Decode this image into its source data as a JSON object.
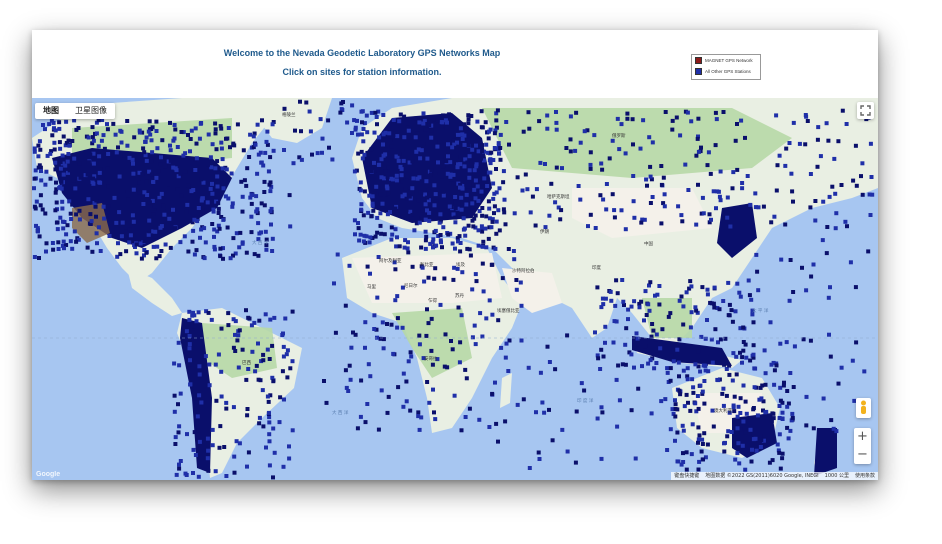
{
  "header": {
    "title": "Welcome to the Nevada Geodetic Laboratory GPS Networks Map",
    "subtitle": "Click on sites for station information."
  },
  "legend": {
    "items": [
      {
        "label": "MAGNET GPS Network",
        "color": "#8b1a1a"
      },
      {
        "label": "All Other GPS Stations",
        "color": "#1f2fa8"
      }
    ]
  },
  "map_controls": {
    "map_type_map": "地图",
    "map_type_satellite": "卫星图像",
    "zoom_in": "+",
    "zoom_out": "−"
  },
  "map_labels": {
    "atlantic_n": "大 西 洋",
    "atlantic_s": "大 西 洋",
    "pacific": "太 平 洋",
    "indian": "印 度 洋",
    "russia": "俄罗斯",
    "kazakhstan": "哈萨克斯坦",
    "algeria": "阿尔及利亚",
    "libya": "利比亚",
    "egypt": "埃及",
    "mali": "马里",
    "niger": "尼日尔",
    "chad": "乍得",
    "sudan": "苏丹",
    "ethiopia": "埃塞俄比亚",
    "saudi": "沙特阿拉伯",
    "iran": "伊朗",
    "india": "印度",
    "china": "中国",
    "brazil": "巴西",
    "angola": "安哥拉",
    "australia": "澳大利亚",
    "greenland": "格陵兰"
  },
  "attribution": {
    "shortcuts": "键盘快捷键",
    "map_data": "地图数据 ©2022 GS(2011)6020 Google, INEGI",
    "scale": "1000 公里",
    "terms": "使用条款"
  },
  "google_logo": "Google",
  "colors": {
    "ocean": "#a7c6f1",
    "land": "#e9efe3",
    "forest": "#b7d8a6",
    "desert": "#f2efe6",
    "station": "#1f2fa8",
    "station_dense": "#0a0f6b",
    "magnet": "#8b1a1a"
  }
}
